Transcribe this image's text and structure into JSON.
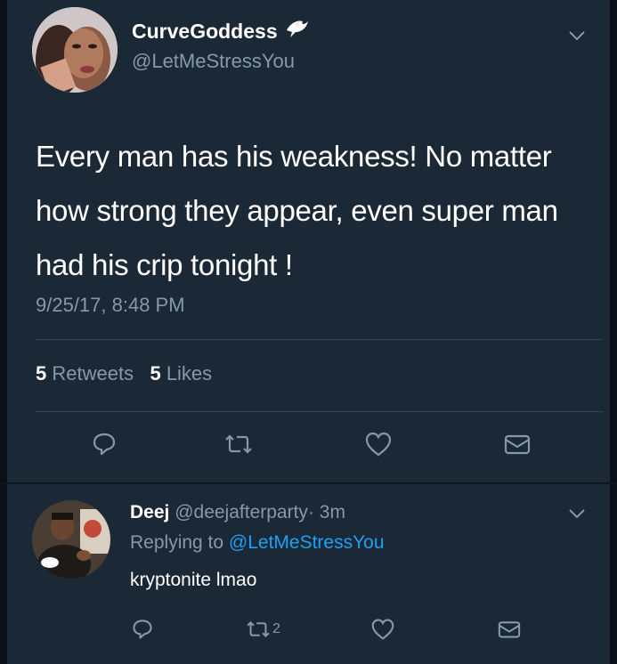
{
  "main_tweet": {
    "display_name": "CurveGoddess",
    "handle": "@LetMeStressYou",
    "text": "Every man has his weakness! No matter how strong they appear, even super man had his crip tonight !",
    "timestamp": "9/25/17, 8:48 PM",
    "retweets_count": "5",
    "retweets_label": "Retweets",
    "likes_count": "5",
    "likes_label": "Likes"
  },
  "reply": {
    "display_name": "Deej",
    "handle": "@deejafterparty",
    "separator": "·",
    "time": "3m",
    "replying_prefix": "Replying to",
    "replying_mention": "@LetMeStressYou",
    "text": "kryptonite lmao",
    "retweet_count": "2"
  },
  "icons": {
    "verified_badge": "dove-emoji",
    "menu": "chevron-down-icon",
    "reply": "reply-icon",
    "retweet": "retweet-icon",
    "like": "heart-icon",
    "dm": "mail-icon"
  },
  "colors": {
    "background": "#1b2836",
    "text_secondary": "#8899a6",
    "link": "#1da1f2",
    "divider": "#38444d"
  }
}
